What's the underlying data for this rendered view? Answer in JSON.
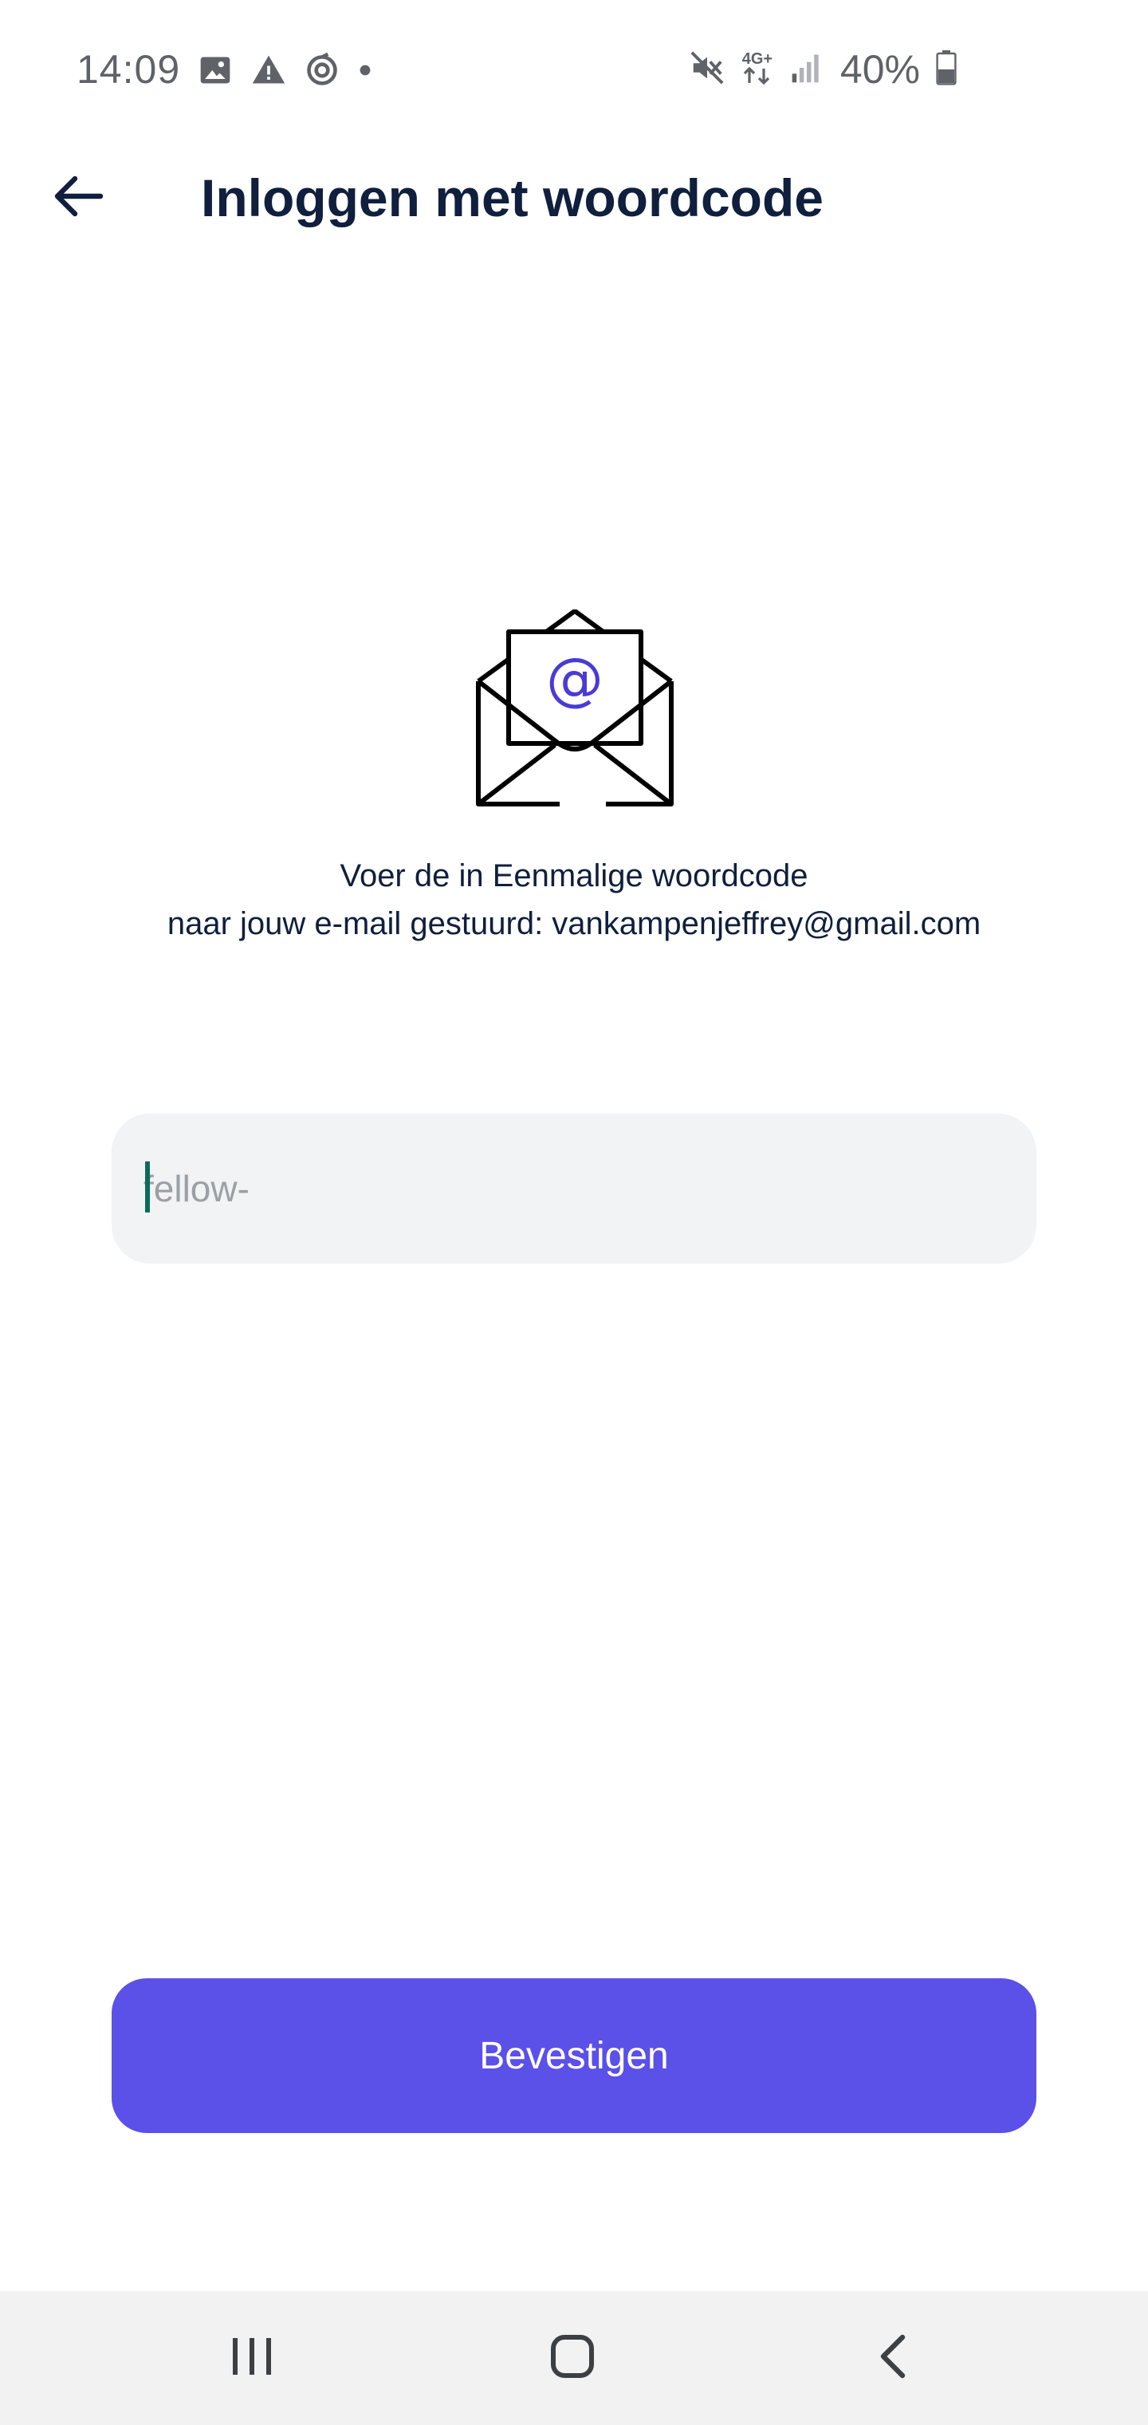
{
  "status_bar": {
    "time": "14:09",
    "network_label_top": "4G+",
    "battery_percent": "40%",
    "icons": [
      "image-icon",
      "warning-icon",
      "sync-icon",
      "dot-icon",
      "mute-icon",
      "network-icon",
      "signal-icon",
      "battery-icon"
    ]
  },
  "header": {
    "back_icon": "arrow-left-icon",
    "title": "Inloggen met woordcode"
  },
  "main": {
    "envelope_icon": "envelope-at-icon",
    "instruction_line1": "Voer de in Eenmalige woordcode",
    "instruction_line2": "naar jouw e-mail gestuurd: vankampenjeffrey@gmail.com",
    "code_input": {
      "placeholder": "fellow-",
      "value": ""
    },
    "confirm_label": "Bevestigen"
  },
  "nav_bar": {
    "recents_icon": "recents-icon",
    "home_icon": "home-icon",
    "back_icon": "nav-back-icon"
  },
  "colors": {
    "accent": "#5b50e8",
    "title": "#0f1f3d",
    "input_bg": "#f1f3f4",
    "caret": "#0b6b5a",
    "at_sign": "#4a3bd6"
  }
}
